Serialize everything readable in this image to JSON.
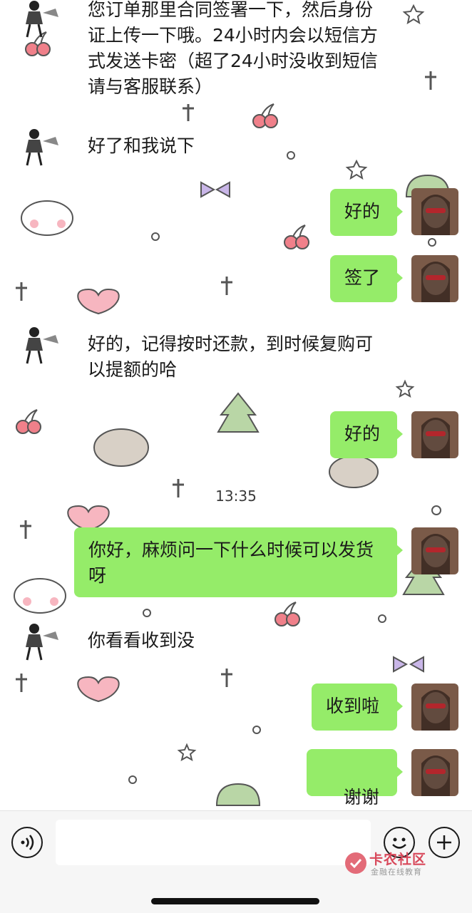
{
  "colors": {
    "bubble_sent": "#95ec69",
    "text": "#1a1a1a",
    "input_bar": "#f6f6f6",
    "watermark": "#d8485a"
  },
  "messages": [
    {
      "side": "received",
      "text": "您订单那里合同签署一下，然后身份证上传一下哦。24小时内会以短信方式发送卡密（超了24小时没收到短信请与客服联系）"
    },
    {
      "side": "received",
      "text": "好了和我说下"
    },
    {
      "side": "sent",
      "text": "好的"
    },
    {
      "side": "sent",
      "text": "签了"
    },
    {
      "side": "received",
      "text": "好的，记得按时还款，到时候复购可以提额的哈"
    },
    {
      "side": "sent",
      "text": "好的"
    },
    {
      "side": "sent",
      "text": "你好，麻烦问一下什么时候可以发货呀"
    },
    {
      "side": "received",
      "text": "你看看收到没"
    },
    {
      "side": "sent",
      "text": "收到啦"
    },
    {
      "side": "sent",
      "text": "谢谢",
      "emoji": "grinning-face-icon"
    }
  ],
  "timestamp": "13:35",
  "input_bar": {
    "voice_icon": "voice-icon",
    "emoji_icon": "emoji-icon",
    "plus_icon": "plus-icon"
  },
  "watermark": {
    "title": "卡农社区",
    "subtitle": "金融在线教育"
  }
}
